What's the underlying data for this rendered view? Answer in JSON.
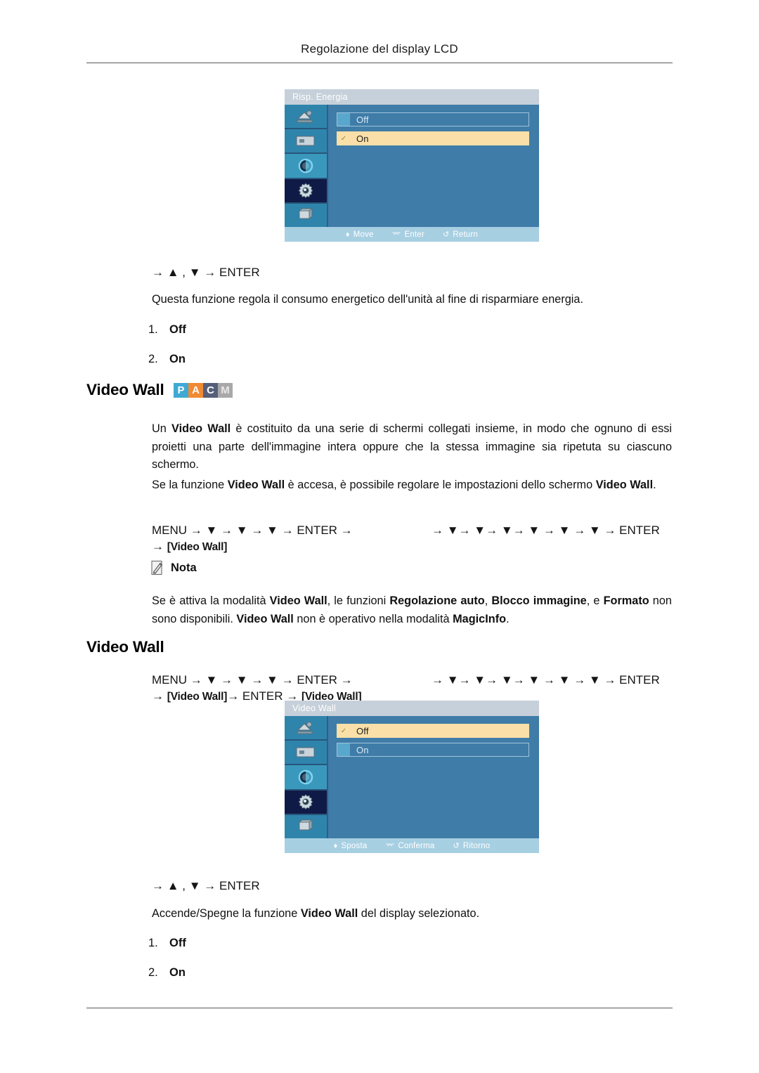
{
  "page": {
    "running_header": "Regolazione del display LCD"
  },
  "osd_power": {
    "title": "Risp. Energia",
    "options": [
      {
        "label": "Off",
        "selected": false
      },
      {
        "label": "On",
        "selected": true
      }
    ],
    "footer": [
      {
        "icon": "updown-arrow-icon",
        "label": "Move"
      },
      {
        "icon": "enter-key-icon",
        "label": "Enter"
      },
      {
        "icon": "return-arrow-icon",
        "label": "Return"
      }
    ],
    "rail_icons": [
      "picture-icon",
      "screen-icon",
      "contrast-icon",
      "setup-gear-icon",
      "multi-control-icon"
    ],
    "active_rail_index": 3,
    "colors": {
      "title_bar": "#c6d0da",
      "body": "#3f7ca8",
      "rail": "#2f84ac",
      "rail_active": "#101a46",
      "selected_row": "#fadfa8",
      "footer": "#a7cfe2"
    }
  },
  "section_power": {
    "nav": "→ ▲ , ▼ → ENTER",
    "description": "Questa funzione regola il consumo energetico dell'unità al fine di risparmiare energia.",
    "items": [
      {
        "num": "1.",
        "value": "Off"
      },
      {
        "num": "2.",
        "value": "On"
      }
    ]
  },
  "section_videowall_1": {
    "heading": "Video Wall",
    "badges": [
      "P",
      "A",
      "C",
      "M"
    ],
    "badge_colors": [
      "#3fa9d4",
      "#f08a33",
      "#565f79",
      "#a8a8a8"
    ],
    "paragraph_1_pre": "Un ",
    "paragraph_1_bold": "Video Wall",
    "paragraph_1_post": " è costituito da una serie di schermi collegati insieme, in modo che ognuno di essi proietti una parte dell'immagine intera oppure che la stessa immagine sia ripetuta su ciascuno schermo.",
    "paragraph_2_pre": "Se la funzione ",
    "paragraph_2_bold_1": "Video Wall",
    "paragraph_2_mid": " è accesa, è possibile regolare le impostazioni dello schermo ",
    "paragraph_2_bold_2": "Video Wall",
    "paragraph_2_post": ".",
    "nav_left_line1": "MENU → ▼ → ▼ → ▼ → ENTER →",
    "nav_left_line2_arrow": "→ ",
    "nav_left_line2_brk": "[Video Wall]",
    "nav_right": "→ ▼→ ▼→ ▼→ ▼ → ▼ → ▼ → ENTER",
    "note": {
      "icon": "note-pencil-icon",
      "label": "Nota",
      "text_parts": [
        {
          "t": "Se è attiva la modalità ",
          "b": false
        },
        {
          "t": "Video Wall",
          "b": true
        },
        {
          "t": ", le funzioni ",
          "b": false
        },
        {
          "t": "Regolazione auto",
          "b": true
        },
        {
          "t": ", ",
          "b": false
        },
        {
          "t": "Blocco immagine",
          "b": true
        },
        {
          "t": ", e ",
          "b": false
        },
        {
          "t": "Formato",
          "b": true
        },
        {
          "t": " non sono disponibili. ",
          "b": false
        },
        {
          "t": "Video Wall",
          "b": true
        },
        {
          "t": " non è operativo nella modalità ",
          "b": false
        },
        {
          "t": "MagicInfo",
          "b": true
        },
        {
          "t": ".",
          "b": false
        }
      ]
    }
  },
  "section_videowall_2": {
    "heading": "Video Wall",
    "nav_left_line1": "MENU → ▼ → ▼ → ▼ → ENTER →",
    "nav_left_line2_arrow": "→ ",
    "nav_left_line2_brk1": "[Video Wall]",
    "nav_left_line2_mid": "→ ENTER → ",
    "nav_left_line2_brk2": "[Video Wall]",
    "nav_right": "→ ▼→ ▼→ ▼→ ▼ → ▼ → ▼ → ENTER",
    "nav_after": "→ ▲ , ▼ → ENTER",
    "description_pre": "Accende/Spegne la funzione ",
    "description_bold": "Video Wall",
    "description_post": " del display selezionato.",
    "items": [
      {
        "num": "1.",
        "value": "Off"
      },
      {
        "num": "2.",
        "value": "On"
      }
    ]
  },
  "osd_videowall": {
    "title": "Video Wall",
    "options": [
      {
        "label": "Off",
        "selected": true
      },
      {
        "label": "On",
        "selected": false
      }
    ],
    "footer": [
      {
        "icon": "updown-arrow-icon",
        "label": "Sposta"
      },
      {
        "icon": "enter-key-icon",
        "label": "Conferma"
      },
      {
        "icon": "return-arrow-icon",
        "label": "Ritorno"
      }
    ],
    "rail_icons": [
      "picture-icon",
      "screen-icon",
      "contrast-icon",
      "setup-gear-icon",
      "multi-control-icon"
    ],
    "active_rail_index": 3
  }
}
